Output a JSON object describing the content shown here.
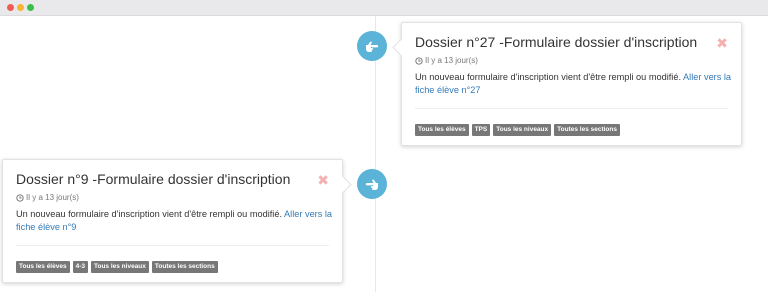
{
  "window": {
    "controls": [
      "close",
      "minimize",
      "maximize"
    ]
  },
  "timeline": {
    "items": [
      {
        "title": "Dossier n°27 -Formulaire dossier d'inscription",
        "time_icon": "clock-icon",
        "time": "Il y a 13 jour(s)",
        "message": "Un nouveau formulaire d'inscription vient d'être rempli ou modifié. ",
        "link_text": "Aller vers la fiche élève n°27",
        "close_symbol": "✖",
        "node_icon": "hand-pointer-icon",
        "tags": [
          "Tous les élèves",
          "TPS",
          "Tous les niveaux",
          "Toutes les sections"
        ]
      },
      {
        "title": "Dossier n°9 -Formulaire dossier d'inscription",
        "time_icon": "clock-icon",
        "time": "Il y a 13 jour(s)",
        "message": "Un nouveau formulaire d'inscription vient d'être rempli ou modifié. ",
        "link_text": "Aller vers la fiche élève n°9",
        "close_symbol": "✖",
        "node_icon": "hand-pointer-icon",
        "tags": [
          "Tous les élèves",
          "4-3",
          "Tous les niveaux",
          "Toutes les sections"
        ]
      }
    ]
  },
  "colors": {
    "node": "#5bb4d7",
    "link": "#337ab7",
    "tag_bg": "#777777",
    "close": "#f3b1b1",
    "timeline_line": "#e7e7ec"
  }
}
